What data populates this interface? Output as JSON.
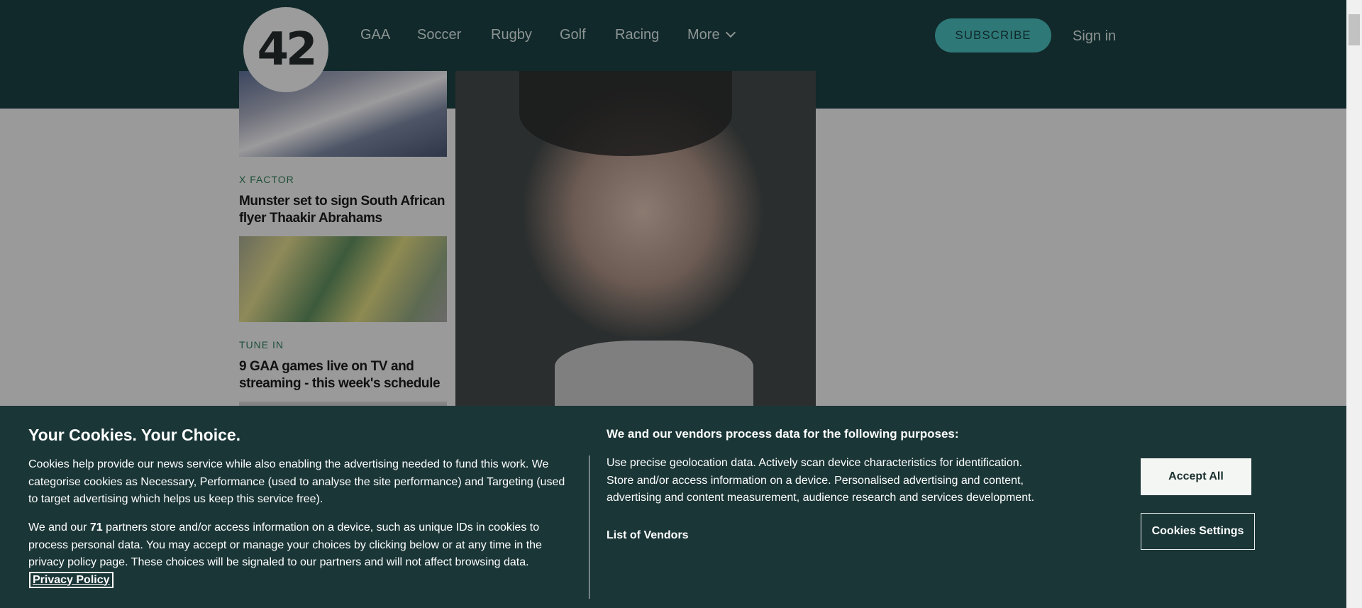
{
  "header": {
    "logo_text": "42",
    "nav": [
      {
        "label": "GAA"
      },
      {
        "label": "Soccer"
      },
      {
        "label": "Rugby"
      },
      {
        "label": "Golf"
      },
      {
        "label": "Racing"
      },
      {
        "label": "More"
      }
    ],
    "subscribe_label": "SUBSCRIBE",
    "signin_label": "Sign in"
  },
  "articles": [
    {
      "kicker": "X FACTOR",
      "headline": "Munster set to sign South African flyer Thaakir Abrahams"
    },
    {
      "kicker": "TUNE IN",
      "headline": "9 GAA games live on TV and streaming - this week's schedule"
    }
  ],
  "cookie": {
    "title": "Your Cookies. Your Choice.",
    "para1": "Cookies help provide our news service while also enabling the advertising needed to fund this work. We categorise cookies as Necessary, Performance (used to analyse the site performance) and Targeting (used to target advertising which helps us keep this service free).",
    "para2_before": "We and our ",
    "para2_count": "71",
    "para2_after": " partners store and/or access information on a device, such as unique IDs in cookies to process personal data. You may accept or manage your choices by clicking below or at any time in the privacy policy page. These choices will be signaled to our partners and will not affect browsing data.",
    "privacy_link": "Privacy Policy",
    "purposes_title": "We and our vendors process data for the following purposes:",
    "purposes_text": "Use precise geolocation data. Actively scan device characteristics for identification. Store and/or access information on a device. Personalised advertising and content, advertising and content measurement, audience research and services development.",
    "vendors_link": "List of Vendors",
    "accept_label": "Accept All",
    "settings_label": "Cookies Settings"
  },
  "colors": {
    "header_bg": "#11292a",
    "banner_bg": "#1b3637",
    "accent": "#2f7878"
  }
}
